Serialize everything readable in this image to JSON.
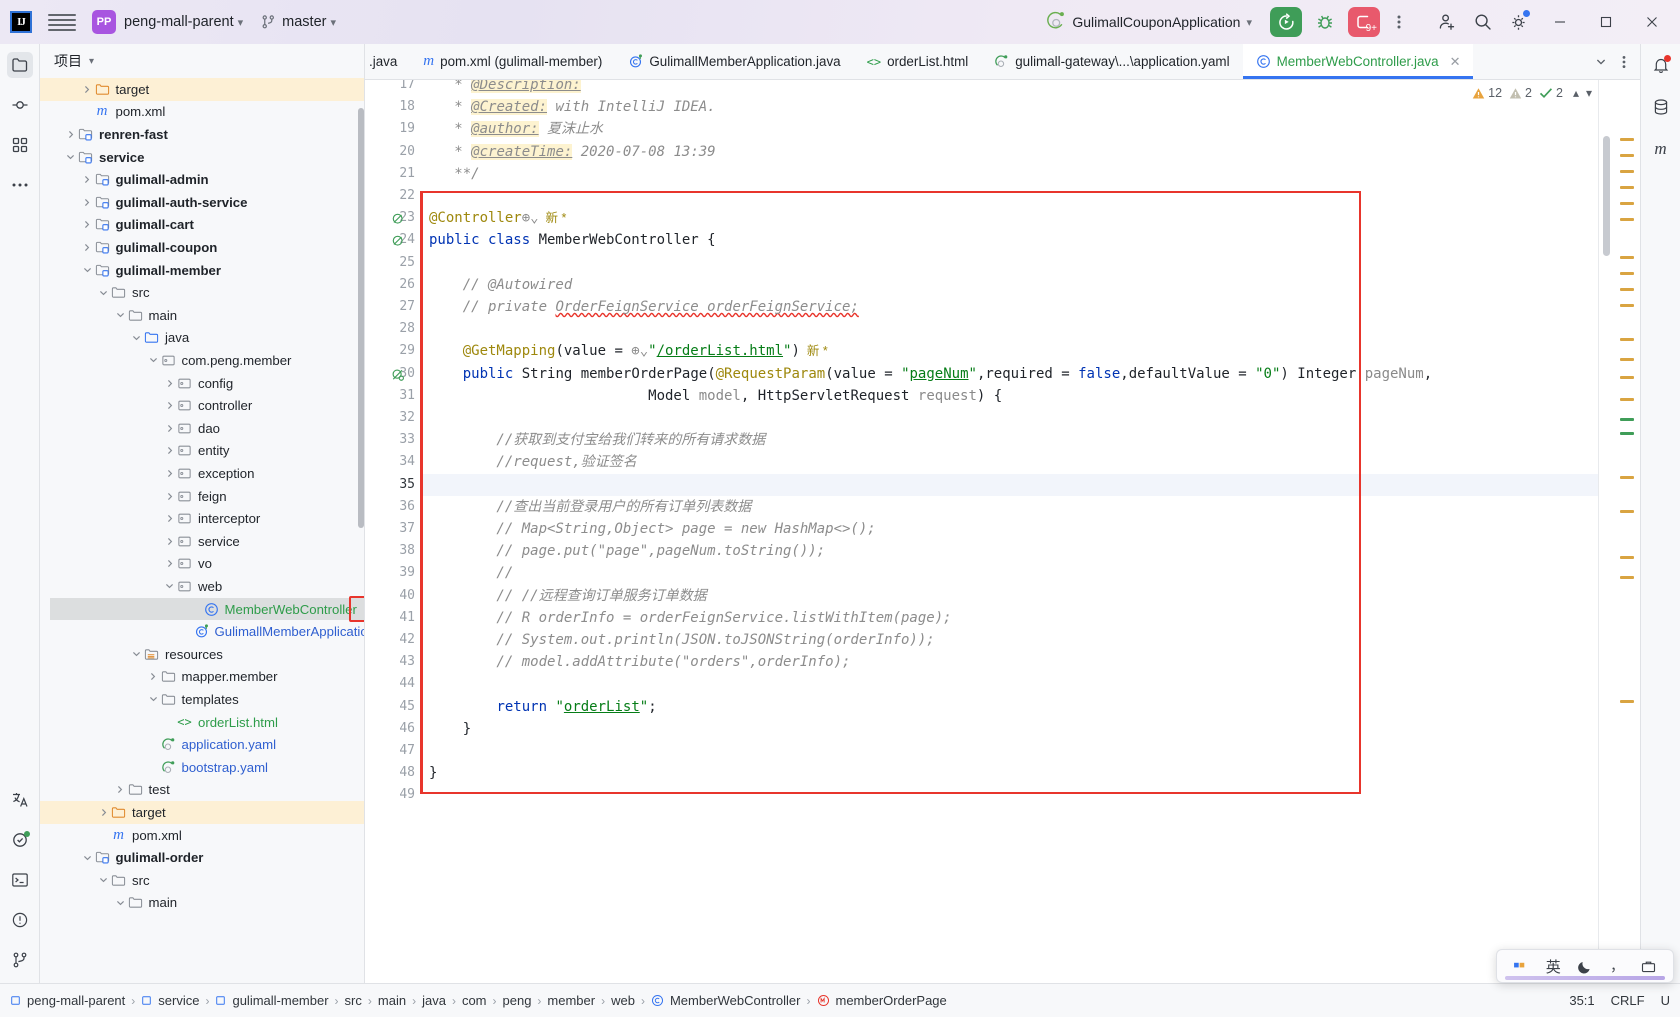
{
  "titlebar": {
    "logo": "IJ",
    "menu_icon": "hamburger-icon",
    "project_badge": "PP",
    "project_name": "peng-mall-parent",
    "branch_icon": "git-branch-icon",
    "branch_name": "master",
    "run_config": "GulimallCouponApplication",
    "run_button": "run-icon",
    "debug_button": "debug-icon",
    "stop_count": "9+",
    "more_button": "more-vertical-icon",
    "account_button": "add-user-icon",
    "search_button": "search-icon",
    "settings_button": "gear-icon",
    "minimize": "–",
    "maximize": "□",
    "close": "×"
  },
  "rail": {
    "items": [
      {
        "name": "project-tool-window",
        "icon": "folder-icon",
        "active": true
      },
      {
        "name": "commit-tool-window",
        "icon": "commit-icon",
        "active": false
      },
      {
        "name": "structure-tool-window",
        "icon": "structure-icon",
        "active": false
      },
      {
        "name": "more-tool-windows",
        "icon": "ellipsis-icon",
        "active": false
      }
    ],
    "bottom_items": [
      {
        "name": "translation-tool-window",
        "icon": "translate-icon"
      },
      {
        "name": "services-tool-window",
        "icon": "services-icon"
      },
      {
        "name": "terminal-tool-window",
        "icon": "terminal-icon"
      },
      {
        "name": "problems-tool-window",
        "icon": "warning-circle-icon"
      },
      {
        "name": "git-tool-window",
        "icon": "git-icon"
      }
    ],
    "right_items": [
      {
        "name": "notifications",
        "icon": "bell-icon"
      },
      {
        "name": "database-tool-window",
        "icon": "database-icon"
      },
      {
        "name": "maven-tool-window",
        "icon": "maven-m-icon"
      }
    ]
  },
  "project_panel": {
    "title": "项目",
    "title_chevron": "chevron-down-icon",
    "tree": [
      {
        "label": "target",
        "indent": 3,
        "arrow": "right",
        "icon": "folder-orange",
        "style": "plain",
        "hl": "target"
      },
      {
        "label": "pom.xml",
        "indent": 3,
        "arrow": "none",
        "icon": "maven-m",
        "style": "plain"
      },
      {
        "label": "renren-fast",
        "indent": 2,
        "arrow": "right",
        "icon": "module",
        "style": "bold"
      },
      {
        "label": "service",
        "indent": 2,
        "arrow": "down",
        "icon": "module",
        "style": "bold"
      },
      {
        "label": "gulimall-admin",
        "indent": 3,
        "arrow": "right",
        "icon": "module",
        "style": "bold"
      },
      {
        "label": "gulimall-auth-service",
        "indent": 3,
        "arrow": "right",
        "icon": "module",
        "style": "bold"
      },
      {
        "label": "gulimall-cart",
        "indent": 3,
        "arrow": "right",
        "icon": "module",
        "style": "bold"
      },
      {
        "label": "gulimall-coupon",
        "indent": 3,
        "arrow": "right",
        "icon": "module",
        "style": "bold"
      },
      {
        "label": "gulimall-member",
        "indent": 3,
        "arrow": "down",
        "icon": "module",
        "style": "bold"
      },
      {
        "label": "src",
        "indent": 4,
        "arrow": "down",
        "icon": "folder",
        "style": "plain"
      },
      {
        "label": "main",
        "indent": 5,
        "arrow": "down",
        "icon": "folder",
        "style": "plain"
      },
      {
        "label": "java",
        "indent": 6,
        "arrow": "down",
        "icon": "folder-src",
        "style": "plain"
      },
      {
        "label": "com.peng.member",
        "indent": 7,
        "arrow": "down",
        "icon": "package",
        "style": "plain"
      },
      {
        "label": "config",
        "indent": 8,
        "arrow": "right",
        "icon": "package",
        "style": "plain"
      },
      {
        "label": "controller",
        "indent": 8,
        "arrow": "right",
        "icon": "package",
        "style": "plain"
      },
      {
        "label": "dao",
        "indent": 8,
        "arrow": "right",
        "icon": "package",
        "style": "plain"
      },
      {
        "label": "entity",
        "indent": 8,
        "arrow": "right",
        "icon": "package",
        "style": "plain"
      },
      {
        "label": "exception",
        "indent": 8,
        "arrow": "right",
        "icon": "package",
        "style": "plain"
      },
      {
        "label": "feign",
        "indent": 8,
        "arrow": "right",
        "icon": "package",
        "style": "plain"
      },
      {
        "label": "interceptor",
        "indent": 8,
        "arrow": "right",
        "icon": "package",
        "style": "plain"
      },
      {
        "label": "service",
        "indent": 8,
        "arrow": "right",
        "icon": "package",
        "style": "plain"
      },
      {
        "label": "vo",
        "indent": 8,
        "arrow": "right",
        "icon": "package",
        "style": "plain"
      },
      {
        "label": "web",
        "indent": 8,
        "arrow": "down",
        "icon": "package",
        "style": "plain"
      },
      {
        "label": "MemberWebController",
        "indent": 9,
        "arrow": "none",
        "icon": "java-class",
        "style": "green",
        "selected": true
      },
      {
        "label": "GulimallMemberApplication",
        "indent": 9,
        "arrow": "none",
        "icon": "spring-class",
        "style": "blue"
      },
      {
        "label": "resources",
        "indent": 6,
        "arrow": "down",
        "icon": "folder-res",
        "style": "plain"
      },
      {
        "label": "mapper.member",
        "indent": 7,
        "arrow": "right",
        "icon": "folder",
        "style": "plain"
      },
      {
        "label": "templates",
        "indent": 7,
        "arrow": "down",
        "icon": "folder",
        "style": "plain"
      },
      {
        "label": "orderList.html",
        "indent": 8,
        "arrow": "none",
        "icon": "html",
        "style": "green"
      },
      {
        "label": "application.yaml",
        "indent": 7,
        "arrow": "none",
        "icon": "yaml",
        "style": "blue"
      },
      {
        "label": "bootstrap.yaml",
        "indent": 7,
        "arrow": "none",
        "icon": "yaml",
        "style": "blue"
      },
      {
        "label": "test",
        "indent": 5,
        "arrow": "right",
        "icon": "folder",
        "style": "plain"
      },
      {
        "label": "target",
        "indent": 4,
        "arrow": "right",
        "icon": "folder-orange",
        "style": "plain",
        "hl": "target"
      },
      {
        "label": "pom.xml",
        "indent": 4,
        "arrow": "none",
        "icon": "maven-m",
        "style": "plain"
      },
      {
        "label": "gulimall-order",
        "indent": 3,
        "arrow": "down",
        "icon": "module",
        "style": "bold"
      },
      {
        "label": "src",
        "indent": 4,
        "arrow": "down",
        "icon": "folder",
        "style": "plain"
      },
      {
        "label": "main",
        "indent": 5,
        "arrow": "down",
        "icon": "folder",
        "style": "plain"
      }
    ]
  },
  "tabs": {
    "items": [
      {
        "label": ".java",
        "icon": "java-class-icon",
        "active": false,
        "truncated": true
      },
      {
        "label": "pom.xml (gulimall-member)",
        "icon": "maven-m-icon",
        "active": false
      },
      {
        "label": "GulimallMemberApplication.java",
        "icon": "spring-class-icon",
        "active": false
      },
      {
        "label": "orderList.html",
        "icon": "html-icon",
        "active": false
      },
      {
        "label": "gulimall-gateway\\...\\application.yaml",
        "icon": "yaml-icon",
        "active": false
      },
      {
        "label": "MemberWebController.java",
        "icon": "java-class-icon",
        "active": true,
        "close": "×"
      }
    ],
    "actions": [
      {
        "name": "tab-list-dropdown",
        "icon": "chevron-down-icon"
      },
      {
        "name": "tab-options-menu",
        "icon": "more-vertical-icon"
      }
    ]
  },
  "inspection": {
    "warnings_icon": "warning-triangle-icon",
    "warnings": "12",
    "weak_warnings_icon": "weak-warning-triangle-icon",
    "weak_warnings": "2",
    "typos_icon": "check-icon",
    "typos": "2",
    "prev_icon": "chevron-up-icon",
    "next_icon": "chevron-down-icon"
  },
  "editor": {
    "first_line": 17,
    "caret_line": 35,
    "lines": [
      {
        "n": 17,
        "segments": [
          {
            "t": "   * ",
            "c": "cm"
          },
          {
            "t": "@Description:",
            "c": "cm hlyellow undb"
          }
        ]
      },
      {
        "n": 18,
        "segments": [
          {
            "t": "   * ",
            "c": "cm"
          },
          {
            "t": "@Created:",
            "c": "cm hlyellow undb"
          },
          {
            "t": " with IntelliJ IDEA.",
            "c": "cm"
          }
        ]
      },
      {
        "n": 19,
        "segments": [
          {
            "t": "   * ",
            "c": "cm"
          },
          {
            "t": "@author:",
            "c": "cm hlyellow undb"
          },
          {
            "t": " ",
            "c": "cm"
          },
          {
            "t": "夏沫止水",
            "c": "cmzh"
          }
        ]
      },
      {
        "n": 20,
        "segments": [
          {
            "t": "   * ",
            "c": "cm"
          },
          {
            "t": "@createTime:",
            "c": "cm hlyellow undb"
          },
          {
            "t": " 2020-07-08 13:39",
            "c": "cm"
          }
        ]
      },
      {
        "n": 21,
        "segments": [
          {
            "t": "   **/",
            "c": "cm"
          }
        ]
      },
      {
        "n": 22,
        "segments": []
      },
      {
        "n": 23,
        "segments": [
          {
            "t": "@Controller",
            "c": "ann"
          },
          {
            "t": "⊕⌄",
            "c": "pm"
          },
          {
            "t": "  新 *",
            "c": "newtag"
          }
        ],
        "gutter_icon": "bean-icon"
      },
      {
        "n": 24,
        "segments": [
          {
            "t": "public class ",
            "c": "k"
          },
          {
            "t": "MemberWebController {",
            "c": "pl"
          }
        ],
        "gutter_icon": "bean-icon"
      },
      {
        "n": 25,
        "segments": []
      },
      {
        "n": 26,
        "segments": [
          {
            "t": "    // @Autowired",
            "c": "cm"
          }
        ]
      },
      {
        "n": 27,
        "segments": [
          {
            "t": "    // private ",
            "c": "cm"
          },
          {
            "t": "OrderFeignService orderFeignService;",
            "c": "cm wavy"
          }
        ]
      },
      {
        "n": 28,
        "segments": []
      },
      {
        "n": 29,
        "segments": [
          {
            "t": "    @GetMapping",
            "c": "ann"
          },
          {
            "t": "(value = ",
            "c": "pl"
          },
          {
            "t": "⊕⌄",
            "c": "pm"
          },
          {
            "t": "\"",
            "c": "str"
          },
          {
            "t": "/orderList.html",
            "c": "str und"
          },
          {
            "t": "\"",
            "c": "str"
          },
          {
            "t": ")",
            "c": "pl"
          },
          {
            "t": "  新 *",
            "c": "newtag"
          }
        ]
      },
      {
        "n": 30,
        "segments": [
          {
            "t": "    ",
            "c": "pl"
          },
          {
            "t": "public ",
            "c": "k"
          },
          {
            "t": "String ",
            "c": "pl"
          },
          {
            "t": "memberOrderPage",
            "c": "pl"
          },
          {
            "t": "(",
            "c": "pl"
          },
          {
            "t": "@RequestParam",
            "c": "ann"
          },
          {
            "t": "(value = ",
            "c": "pl"
          },
          {
            "t": "\"",
            "c": "str"
          },
          {
            "t": "pageNum",
            "c": "str und"
          },
          {
            "t": "\"",
            "c": "str"
          },
          {
            "t": ",required = ",
            "c": "pl"
          },
          {
            "t": "false",
            "c": "k"
          },
          {
            "t": ",defaultValue = ",
            "c": "pl"
          },
          {
            "t": "\"0\"",
            "c": "str"
          },
          {
            "t": ") Integer ",
            "c": "pl"
          },
          {
            "t": "pageNum",
            "c": "pm"
          },
          {
            "t": ",",
            "c": "pl"
          }
        ],
        "gutter_icon": "override-icon"
      },
      {
        "n": 31,
        "segments": [
          {
            "t": "                          Model ",
            "c": "pl"
          },
          {
            "t": "model",
            "c": "pm"
          },
          {
            "t": ", HttpServletRequest ",
            "c": "pl"
          },
          {
            "t": "request",
            "c": "pm"
          },
          {
            "t": ") {",
            "c": "pl"
          }
        ]
      },
      {
        "n": 32,
        "segments": []
      },
      {
        "n": 33,
        "segments": [
          {
            "t": "        //",
            "c": "cm"
          },
          {
            "t": "获取到支付宝给我们转来的所有请求数据",
            "c": "cmzh"
          }
        ]
      },
      {
        "n": 34,
        "segments": [
          {
            "t": "        //request,",
            "c": "cm"
          },
          {
            "t": "验证签名",
            "c": "cmzh"
          }
        ]
      },
      {
        "n": 35,
        "segments": []
      },
      {
        "n": 36,
        "segments": [
          {
            "t": "        //",
            "c": "cm"
          },
          {
            "t": "查出当前登录用户的所有订单列表数据",
            "c": "cmzh"
          }
        ]
      },
      {
        "n": 37,
        "segments": [
          {
            "t": "        // Map<String,Object> page = new HashMap<>();",
            "c": "cm"
          }
        ]
      },
      {
        "n": 38,
        "segments": [
          {
            "t": "        // page.put(\"page\",pageNum.toString());",
            "c": "cm"
          }
        ]
      },
      {
        "n": 39,
        "segments": [
          {
            "t": "        //",
            "c": "cm"
          }
        ]
      },
      {
        "n": 40,
        "segments": [
          {
            "t": "        // //",
            "c": "cm"
          },
          {
            "t": "远程查询订单服务订单数据",
            "c": "cmzh"
          }
        ]
      },
      {
        "n": 41,
        "segments": [
          {
            "t": "        // R orderInfo = orderFeignService.listWithItem(page);",
            "c": "cm"
          }
        ]
      },
      {
        "n": 42,
        "segments": [
          {
            "t": "        // System.out.println(JSON.toJSONString(orderInfo));",
            "c": "cm"
          }
        ]
      },
      {
        "n": 43,
        "segments": [
          {
            "t": "        // model.addAttribute(\"orders\",orderInfo);",
            "c": "cm"
          }
        ]
      },
      {
        "n": 44,
        "segments": []
      },
      {
        "n": 45,
        "segments": [
          {
            "t": "        ",
            "c": "pl"
          },
          {
            "t": "return ",
            "c": "k"
          },
          {
            "t": "\"",
            "c": "str"
          },
          {
            "t": "orderList",
            "c": "str und"
          },
          {
            "t": "\"",
            "c": "str"
          },
          {
            "t": ";",
            "c": "pl"
          }
        ]
      },
      {
        "n": 46,
        "segments": [
          {
            "t": "    }",
            "c": "pl"
          }
        ]
      },
      {
        "n": 47,
        "segments": []
      },
      {
        "n": 48,
        "segments": [
          {
            "t": "}",
            "c": "pl"
          }
        ]
      },
      {
        "n": 49,
        "segments": []
      }
    ]
  },
  "statusbar": {
    "breadcrumbs": [
      {
        "label": "peng-mall-parent",
        "icon": "module-icon"
      },
      {
        "label": "service",
        "icon": "module-icon"
      },
      {
        "label": "gulimall-member",
        "icon": "module-icon"
      },
      {
        "label": "src",
        "icon": "none"
      },
      {
        "label": "main",
        "icon": "none"
      },
      {
        "label": "java",
        "icon": "none"
      },
      {
        "label": "com",
        "icon": "none"
      },
      {
        "label": "peng",
        "icon": "none"
      },
      {
        "label": "member",
        "icon": "none"
      },
      {
        "label": "web",
        "icon": "none"
      },
      {
        "label": "MemberWebController",
        "icon": "java-class-icon"
      },
      {
        "label": "memberOrderPage",
        "icon": "method-icon"
      }
    ],
    "separator": "›",
    "caret_position": "35:1",
    "line_separator": "CRLF",
    "encoding": "U"
  },
  "ime": {
    "items": [
      {
        "name": "ime-mode-indicator",
        "glyph": "■■"
      },
      {
        "name": "ime-language-chinese",
        "glyph": "英"
      },
      {
        "name": "ime-moon-icon",
        "glyph": "☾"
      },
      {
        "name": "ime-punctuation-icon",
        "glyph": "，"
      },
      {
        "name": "ime-toolbox-icon",
        "glyph": "⬛"
      }
    ]
  },
  "colors": {
    "accent": "#3574f0",
    "run_green": "#3f9d58",
    "stop_red": "#e8596c",
    "highlight_red": "#e8352c",
    "tree_highlight": "#fdf0d5",
    "selection": "#dcdedf"
  }
}
